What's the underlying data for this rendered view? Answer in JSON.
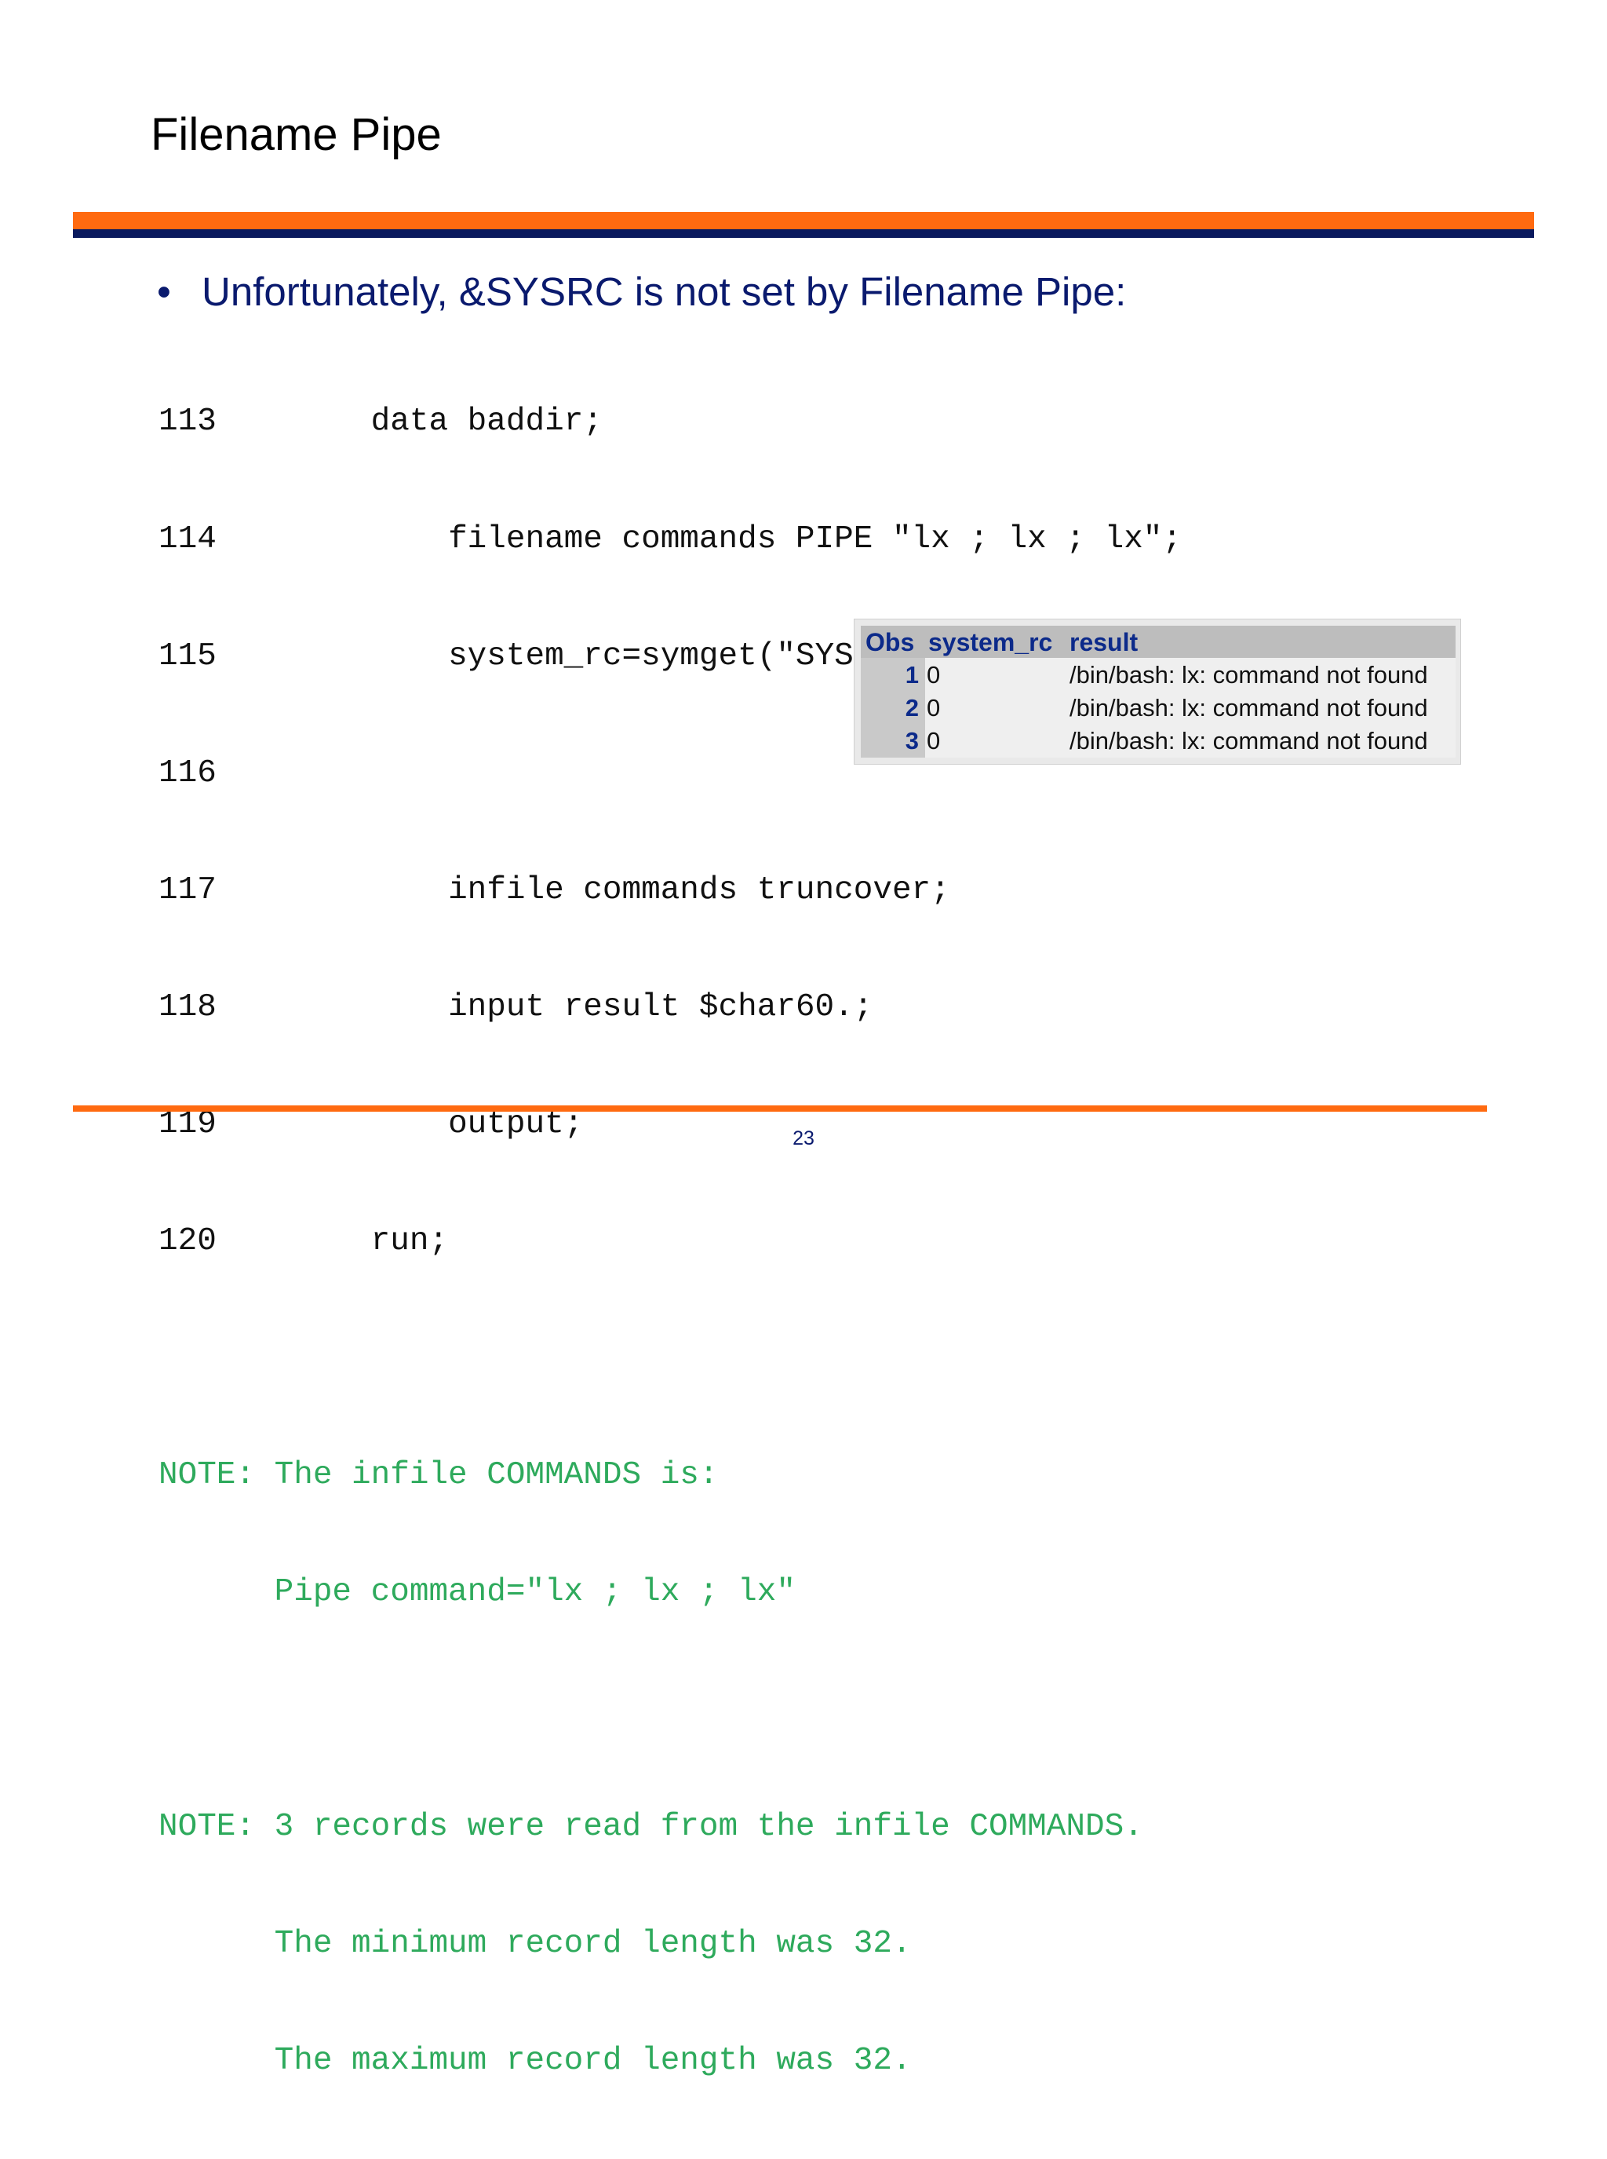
{
  "slide": {
    "title": "Filename Pipe",
    "bullet": {
      "symbol": "•",
      "text": "Unfortunately, &SYSRC is not set by Filename Pipe:"
    },
    "code_lines": [
      {
        "number": "113",
        "text": "data baddir;",
        "indent": 1
      },
      {
        "number": "114",
        "text": "filename commands PIPE \"lx ; lx ; lx\";",
        "indent": 2
      },
      {
        "number": "115",
        "text": "system_rc=symget(\"SYSRC\");",
        "indent": 2
      },
      {
        "number": "116",
        "text": "",
        "indent": 2
      },
      {
        "number": "117",
        "text": "infile commands truncover;",
        "indent": 2
      },
      {
        "number": "118",
        "text": "input result $char60.;",
        "indent": 2
      },
      {
        "number": "119",
        "text": "output;",
        "indent": 2
      },
      {
        "number": "120",
        "text": "run;",
        "indent": 1
      }
    ],
    "notes": [
      "",
      "NOTE: The infile COMMANDS is:",
      "      Pipe command=\"lx ; lx ; lx\"",
      "",
      "NOTE: 3 records were read from the infile COMMANDS.",
      "      The minimum record length was 32.",
      "      The maximum record length was 32."
    ],
    "table": {
      "headers": {
        "obs": "Obs",
        "system_rc": "system_rc",
        "result": "result"
      },
      "rows": [
        {
          "obs": "1",
          "system_rc": "0",
          "result": "/bin/bash: lx: command not found"
        },
        {
          "obs": "2",
          "system_rc": "0",
          "result": "/bin/bash: lx: command not found"
        },
        {
          "obs": "3",
          "system_rc": "0",
          "result": "/bin/bash: lx: command not found"
        }
      ]
    },
    "page_number": "23",
    "colors": {
      "accent_orange": "#ff6a10",
      "navy": "#0a1a5e",
      "note_green": "#2eaa5c",
      "table_header_text": "#0c2a8a"
    }
  }
}
